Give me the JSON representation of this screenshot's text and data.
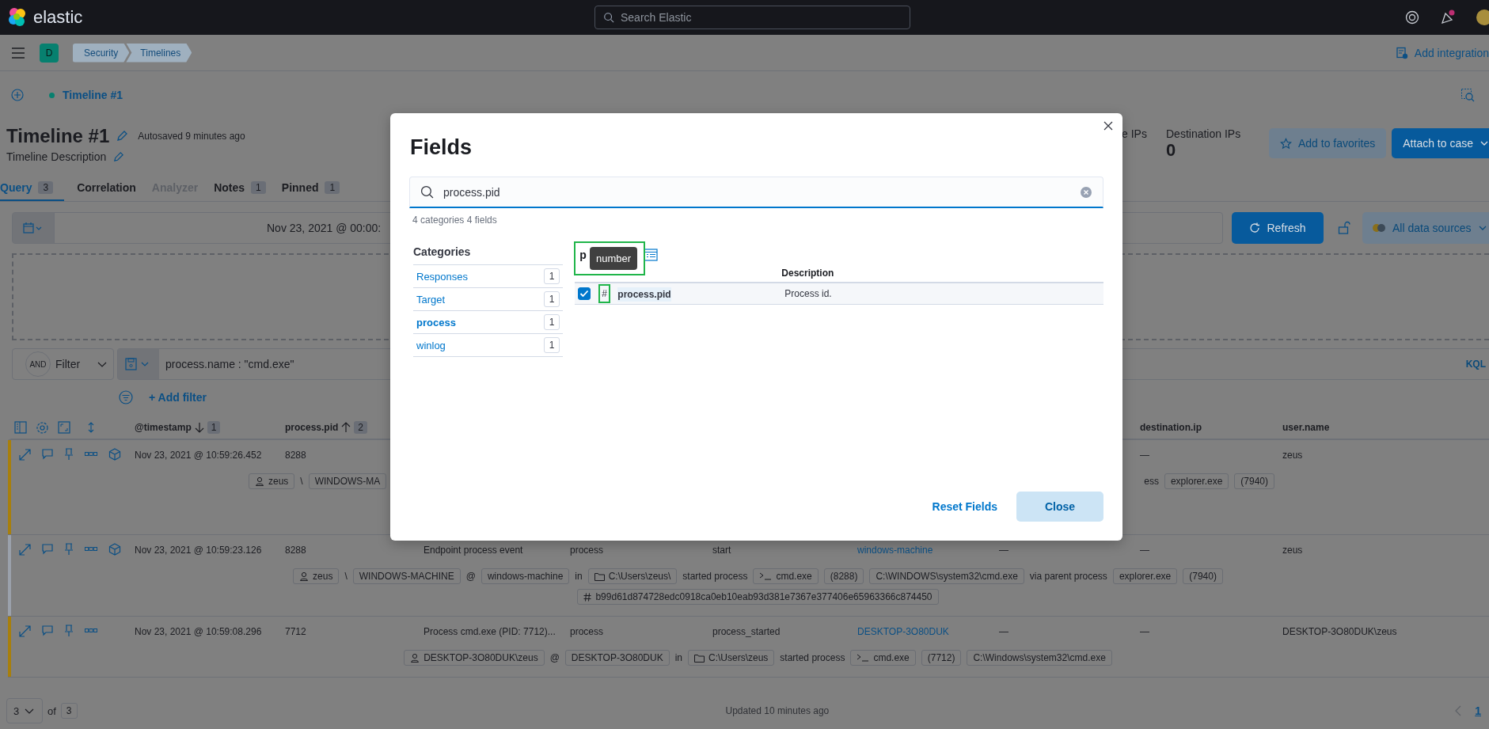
{
  "header": {
    "logo": "elastic",
    "search_placeholder": "Search Elastic"
  },
  "nav": {
    "space": "D",
    "breadcrumbs": [
      "Security",
      "Timelines"
    ],
    "add_integration": "Add integration"
  },
  "timeline_tab": "Timeline #1",
  "title": "Timeline #1",
  "autosaved": "Autosaved 9 minutes ago",
  "description": "Timeline Description",
  "stats": [
    {
      "label": "e IPs"
    },
    {
      "label": "Destination IPs",
      "value": "0"
    }
  ],
  "favorites_button": "Add to favorites",
  "attach_button": "Attach to case",
  "tabs": [
    {
      "label": "Query",
      "count": "3",
      "selected": true,
      "disabled": false
    },
    {
      "label": "Correlation",
      "selected": false,
      "disabled": false
    },
    {
      "label": "Analyzer",
      "selected": false,
      "disabled": true
    },
    {
      "label": "Notes",
      "count": "1",
      "selected": false,
      "disabled": false
    },
    {
      "label": "Pinned",
      "count": "1",
      "selected": false,
      "disabled": false
    }
  ],
  "date_range": "Nov 23, 2021 @ 00:00:",
  "refresh": "Refresh",
  "data_sources": "All data sources",
  "filter": {
    "and": "AND",
    "label": "Filter",
    "query": "process.name : \"cmd.exe\"",
    "language": "KQL",
    "add_filter": "+ Add filter"
  },
  "columns": {
    "timestamp": {
      "label": "@timestamp",
      "sort_descending": true,
      "order": "1"
    },
    "pid": {
      "label": "process.pid",
      "sort_descending": false,
      "order": "2"
    },
    "destination_ip": {
      "label": "destination.ip"
    },
    "user_name": {
      "label": "user.name"
    }
  },
  "rows": [
    {
      "color": "#a87f0c",
      "analyzer": true,
      "timestamp": "Nov 23, 2021 @ 10:59:26.452",
      "pid": "8288",
      "destination_ip": "—",
      "user_name": "zeus",
      "details": [
        {
          "start": [
            {
              "kind": "user",
              "text": "zeus"
            },
            {
              "kind": "text",
              "text": "\\"
            },
            {
              "kind": "chip",
              "text": "WINDOWS-MA"
            }
          ],
          "end": [
            {
              "kind": "text",
              "text": "ess"
            },
            {
              "kind": "chip",
              "text": "explorer.exe"
            },
            {
              "kind": "chip",
              "text": "(7940)"
            }
          ]
        }
      ]
    },
    {
      "color": "#9aa1ab",
      "analyzer": true,
      "timestamp": "Nov 23, 2021 @ 10:59:23.126",
      "pid": "8288",
      "message": "Endpoint process event",
      "category": "process",
      "action": "start",
      "host": "windows-machine",
      "column_7": "—",
      "destination_ip": "—",
      "user_name": "zeus",
      "details": [
        {
          "start": [
            {
              "kind": "user",
              "text": "zeus"
            },
            {
              "kind": "text",
              "text": "\\"
            },
            {
              "kind": "chip",
              "text": "WINDOWS-MACHINE"
            },
            {
              "kind": "text",
              "text": "@"
            },
            {
              "kind": "chip",
              "text": "windows-machine"
            },
            {
              "kind": "text",
              "text": "in"
            },
            {
              "kind": "folder",
              "text": "C:\\Users\\zeus\\"
            },
            {
              "kind": "text",
              "text": "started process"
            },
            {
              "kind": "process",
              "text": "cmd.exe"
            },
            {
              "kind": "chip",
              "text": "(8288)"
            },
            {
              "kind": "chip",
              "text": "C:\\WINDOWS\\system32\\cmd.exe"
            },
            {
              "kind": "text",
              "text": "via parent process"
            },
            {
              "kind": "chip",
              "text": "explorer.exe"
            },
            {
              "kind": "chip",
              "text": "(7940)"
            }
          ]
        },
        {
          "start": [
            {
              "kind": "hash",
              "text": "b99d61d874728edc0918ca0eb10eab93d381e7367e377406e65963366c874450"
            }
          ]
        }
      ]
    },
    {
      "color": "#a87f0c",
      "analyzer": false,
      "timestamp": "Nov 23, 2021 @ 10:59:08.296",
      "pid": "7712",
      "message": "Process cmd.exe (PID: 7712)...",
      "category": "process",
      "action": "process_started",
      "host": "DESKTOP-3O80DUK",
      "column_7": "—",
      "destination_ip": "—",
      "user_name": "DESKTOP-3O80DUK\\zeus",
      "details": [
        {
          "start": [
            {
              "kind": "user",
              "text": "DESKTOP-3O80DUK\\zeus"
            },
            {
              "kind": "text",
              "text": "@"
            },
            {
              "kind": "chip",
              "text": "DESKTOP-3O80DUK"
            },
            {
              "kind": "text",
              "text": "in"
            },
            {
              "kind": "folder",
              "text": "C:\\Users\\zeus"
            },
            {
              "kind": "text",
              "text": "started process"
            },
            {
              "kind": "process",
              "text": "cmd.exe"
            },
            {
              "kind": "chip",
              "text": "(7712)"
            },
            {
              "kind": "chip",
              "text": "C:\\Windows\\system32\\cmd.exe"
            }
          ]
        }
      ]
    }
  ],
  "pagination": {
    "page_size": "3",
    "of": "of",
    "total": "3",
    "updated": "Updated 10 minutes ago",
    "page": "1"
  },
  "fields_modal": {
    "title": "Fields",
    "search_value": "process.pid",
    "summary": "4 categories 4 fields",
    "categories_title": "Categories",
    "categories": [
      {
        "name": "Responses",
        "count": "1",
        "selected": false
      },
      {
        "name": "Target",
        "count": "1",
        "selected": false
      },
      {
        "name": "process",
        "count": "1",
        "selected": true
      },
      {
        "name": "winlog",
        "count": "1",
        "selected": false
      }
    ],
    "table_heading": "p",
    "tooltip": "number",
    "description_header": "Description",
    "fields": [
      {
        "type_icon": "#",
        "name": "process.pid",
        "description": "Process id.",
        "checked": true
      }
    ],
    "reset": "Reset Fields",
    "close": "Close"
  }
}
